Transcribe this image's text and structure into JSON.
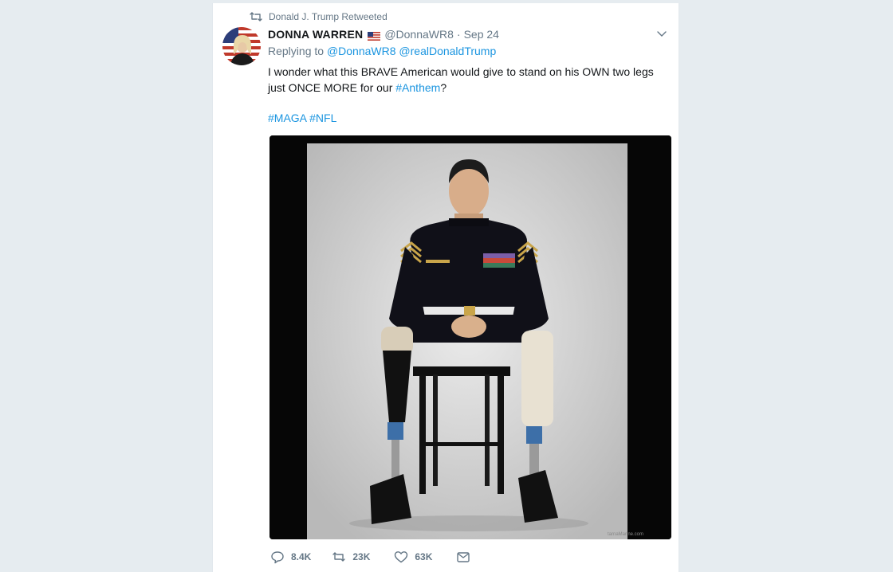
{
  "retweet": {
    "text": "Donald J. Trump Retweeted",
    "icon": "retweet-icon"
  },
  "tweet": {
    "author_name": "DONNA WARREN",
    "flag_icon": "us-flag-icon",
    "handle": "@DonnaWR8",
    "separator": "·",
    "date": "Sep 24",
    "replying_prefix": "Replying to",
    "replying_to": [
      "@DonnaWR8",
      "@realDonaldTrump"
    ],
    "text_before": "I wonder what this BRAVE American would give to stand on his OWN two legs just ONCE MORE for our",
    "text_hashtag": "#Anthem",
    "text_after": "?",
    "hashtags": [
      "#MAGA",
      "#NFL"
    ],
    "image_watermark": "tarnaMarine.com"
  },
  "actions": {
    "reply_count": "8.4K",
    "retweet_count": "23K",
    "like_count": "63K"
  },
  "colors": {
    "link": "#1b95e0",
    "secondary_text": "#657786",
    "page_background": "#e6ecf0"
  }
}
